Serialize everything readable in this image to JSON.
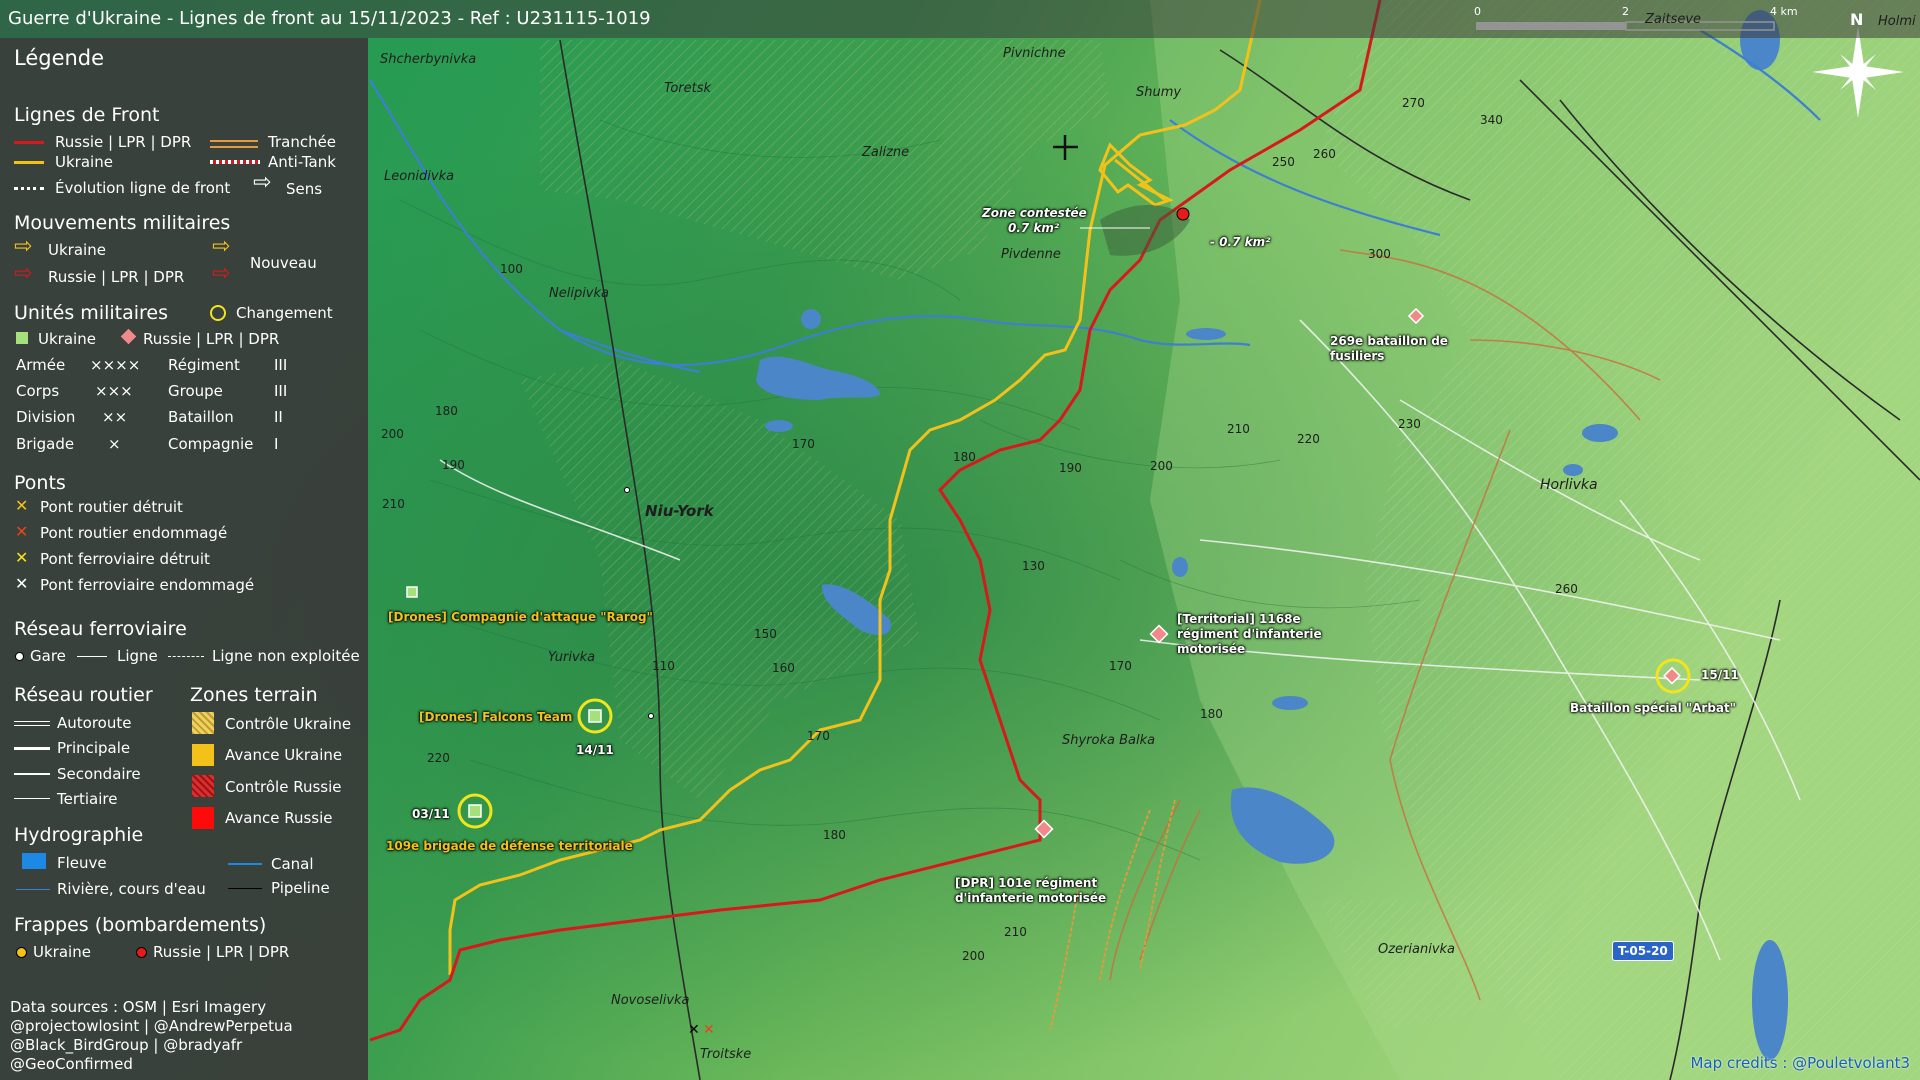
{
  "title": "Guerre d'Ukraine - Lignes de front au 15/11/2023 - Ref : U231115-1019",
  "scale_bar": {
    "labels": [
      "0",
      "2",
      "4 km"
    ]
  },
  "north_label": "N",
  "legend": {
    "title": "Légende",
    "front_lines": {
      "heading": "Lignes de Front",
      "russia": "Russie | LPR | DPR",
      "ukraine": "Ukraine",
      "trench": "Tranchée",
      "antitank": "Anti-Tank",
      "evolution": "Évolution ligne de front",
      "direction": "Sens"
    },
    "movements": {
      "heading": "Mouvements militaires",
      "ukraine": "Ukraine",
      "russia": "Russie | LPR | DPR",
      "new": "Nouveau"
    },
    "units": {
      "heading": "Unités militaires",
      "change": "Changement",
      "ukraine": "Ukraine",
      "russia": "Russie | LPR | DPR",
      "sizes": [
        {
          "label": "Armée",
          "symbol": "××××"
        },
        {
          "label": "Corps",
          "symbol": "×××"
        },
        {
          "label": "Division",
          "symbol": "××"
        },
        {
          "label": "Brigade",
          "symbol": "×"
        }
      ],
      "sizes2": [
        {
          "label": "Régiment",
          "symbol": "III"
        },
        {
          "label": "Groupe",
          "symbol": "III"
        },
        {
          "label": "Bataillon",
          "symbol": "II"
        },
        {
          "label": "Compagnie",
          "symbol": "I"
        }
      ]
    },
    "bridges": {
      "heading": "Ponts",
      "items": [
        "Pont routier détruit",
        "Pont routier endommagé",
        "Pont ferroviaire détruit",
        "Pont ferroviaire endommagé"
      ]
    },
    "rail": {
      "heading": "Réseau ferroviaire",
      "station": "Gare",
      "line": "Ligne",
      "unused": "Ligne non exploitée"
    },
    "roads": {
      "heading": "Réseau routier",
      "items": [
        "Autoroute",
        "Principale",
        "Secondaire",
        "Tertiaire"
      ]
    },
    "zones": {
      "heading": "Zones terrain",
      "items": [
        "Contrôle Ukraine",
        "Avance Ukraine",
        "Contrôle Russie",
        "Avance Russie"
      ]
    },
    "hydro": {
      "heading": "Hydrographie",
      "river": "Fleuve",
      "canal": "Canal",
      "stream": "Rivière, cours d'eau",
      "pipeline": "Pipeline"
    },
    "strikes": {
      "heading": "Frappes (bombardements)",
      "ukraine": "Ukraine",
      "russia": "Russie | LPR | DPR"
    },
    "sources": [
      "Data sources : OSM | Esri Imagery",
      "@projectowlosint | @AndrewPerpetua",
      "@Black_BirdGroup | @bradyafr",
      "@GeoConfirmed"
    ]
  },
  "places": {
    "shcherbynivka": "Shcherbynivka",
    "toretsk": "Toretsk",
    "pivnichne": "Pivnichne",
    "shumy": "Shumy",
    "zalizne": "Zalizne",
    "leonidivka": "Leonidivka",
    "pivdenne": "Pivdenne",
    "nelipivka": "Nelipivka",
    "niu_york": "Niu-York",
    "yurivka": "Yurivka",
    "shyroka_balka": "Shyroka Balka",
    "horlivka": "Horlivka",
    "ozerianivka": "Ozerianivka",
    "novoselivka": "Novoselivka",
    "troitske": "Troitske",
    "zaitseve": "Zaitseve",
    "holmivskyi": "Holmi"
  },
  "elevations": [
    "270",
    "340",
    "250",
    "260",
    "300",
    "100",
    "180",
    "200",
    "190",
    "210",
    "170",
    "180",
    "190",
    "200",
    "210",
    "220",
    "230",
    "130",
    "150",
    "160",
    "110",
    "170",
    "180",
    "220",
    "180",
    "170",
    "260",
    "200",
    "210"
  ],
  "annotations": {
    "contested": "Zone contestée",
    "contested_area": "0.7 km²",
    "russia_gain": "- 0.7 km²"
  },
  "units_on_map": {
    "u269": "269e bataillon de fusiliers",
    "u269_l1": "269e bataillon de",
    "u269_l2": "fusiliers",
    "u1168_l1": "[Territorial] 1168e",
    "u1168_l2": "régiment d'infanterie",
    "u1168_l3": "motorisée",
    "u101_l1": "[DPR] 101e régiment",
    "u101_l2": "d'infanterie motorisée",
    "rarog": "[Drones] Compagnie d'attaque \"Rarog\"",
    "falcons": "[Drones] Falcons Team",
    "falcons_date": "14/11",
    "b109": "109e brigade de défense territoriale",
    "b109_date": "03/11",
    "arbat": "Bataillon spécial \"Arbat\"",
    "arbat_date": "15/11"
  },
  "road_badge": "T-05-20",
  "credits": "Map credits : @Pouletvolant3",
  "colors": {
    "russia": "#d7191c",
    "ukraine": "#f2c21b",
    "water": "#4a86c8"
  }
}
